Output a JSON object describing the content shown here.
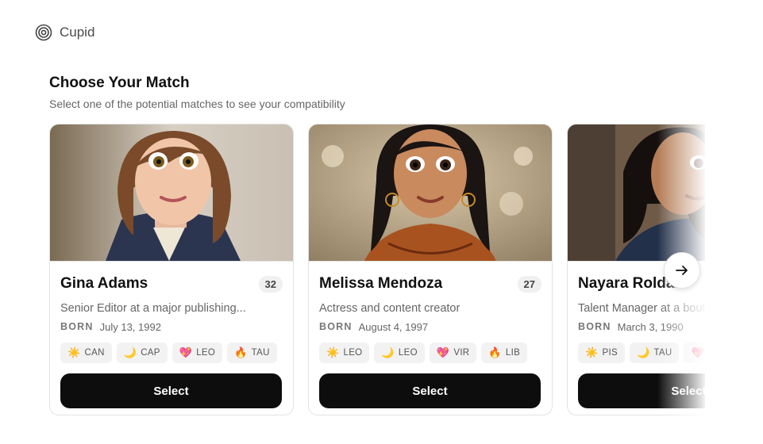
{
  "brand": {
    "name": "Cupid",
    "icon": "target-icon"
  },
  "page": {
    "title": "Choose Your Match",
    "subtitle": "Select one of the potential matches to see your compatibility"
  },
  "colors": {
    "button": "#0d0d0d",
    "tag_bg": "#f2f2f2",
    "border": "#e3e3e3"
  },
  "matches": [
    {
      "name": "Gina Adams",
      "age": "32",
      "occupation": "Senior Editor at a major publishing...",
      "born_label": "BORN",
      "born": "July 13, 1992",
      "tags": [
        {
          "icon": "sun-icon",
          "glyph": "☀️",
          "label": "CAN"
        },
        {
          "icon": "moon-icon",
          "glyph": "🌙",
          "label": "CAP"
        },
        {
          "icon": "heart-icon",
          "glyph": "💖",
          "label": "LEO"
        },
        {
          "icon": "fire-icon",
          "glyph": "🔥",
          "label": "TAU"
        }
      ],
      "select_label": "Select"
    },
    {
      "name": "Melissa Mendoza",
      "age": "27",
      "occupation": "Actress and content creator",
      "born_label": "BORN",
      "born": "August 4, 1997",
      "tags": [
        {
          "icon": "sun-icon",
          "glyph": "☀️",
          "label": "LEO"
        },
        {
          "icon": "moon-icon",
          "glyph": "🌙",
          "label": "LEO"
        },
        {
          "icon": "heart-icon",
          "glyph": "💖",
          "label": "VIR"
        },
        {
          "icon": "fire-icon",
          "glyph": "🔥",
          "label": "LIB"
        }
      ],
      "select_label": "Select"
    },
    {
      "name": "Nayara Roldan",
      "age": "",
      "occupation": "Talent Manager at a boutique agency",
      "born_label": "BORN",
      "born": "March 3, 1990",
      "tags": [
        {
          "icon": "sun-icon",
          "glyph": "☀️",
          "label": "PIS"
        },
        {
          "icon": "moon-icon",
          "glyph": "🌙",
          "label": "TAU"
        },
        {
          "icon": "heart-icon",
          "glyph": "💖",
          "label": ""
        }
      ],
      "select_label": "Select"
    }
  ],
  "next_button": {
    "icon": "arrow-right-icon"
  }
}
